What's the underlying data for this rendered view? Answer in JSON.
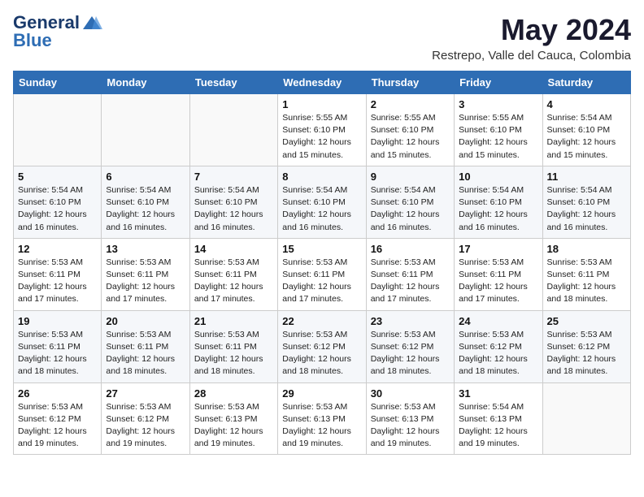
{
  "logo": {
    "line1": "General",
    "line2": "Blue"
  },
  "title": "May 2024",
  "subtitle": "Restrepo, Valle del Cauca, Colombia",
  "days_of_week": [
    "Sunday",
    "Monday",
    "Tuesday",
    "Wednesday",
    "Thursday",
    "Friday",
    "Saturday"
  ],
  "weeks": [
    [
      {
        "day": "",
        "info": ""
      },
      {
        "day": "",
        "info": ""
      },
      {
        "day": "",
        "info": ""
      },
      {
        "day": "1",
        "info": "Sunrise: 5:55 AM\nSunset: 6:10 PM\nDaylight: 12 hours\nand 15 minutes."
      },
      {
        "day": "2",
        "info": "Sunrise: 5:55 AM\nSunset: 6:10 PM\nDaylight: 12 hours\nand 15 minutes."
      },
      {
        "day": "3",
        "info": "Sunrise: 5:55 AM\nSunset: 6:10 PM\nDaylight: 12 hours\nand 15 minutes."
      },
      {
        "day": "4",
        "info": "Sunrise: 5:54 AM\nSunset: 6:10 PM\nDaylight: 12 hours\nand 15 minutes."
      }
    ],
    [
      {
        "day": "5",
        "info": "Sunrise: 5:54 AM\nSunset: 6:10 PM\nDaylight: 12 hours\nand 16 minutes."
      },
      {
        "day": "6",
        "info": "Sunrise: 5:54 AM\nSunset: 6:10 PM\nDaylight: 12 hours\nand 16 minutes."
      },
      {
        "day": "7",
        "info": "Sunrise: 5:54 AM\nSunset: 6:10 PM\nDaylight: 12 hours\nand 16 minutes."
      },
      {
        "day": "8",
        "info": "Sunrise: 5:54 AM\nSunset: 6:10 PM\nDaylight: 12 hours\nand 16 minutes."
      },
      {
        "day": "9",
        "info": "Sunrise: 5:54 AM\nSunset: 6:10 PM\nDaylight: 12 hours\nand 16 minutes."
      },
      {
        "day": "10",
        "info": "Sunrise: 5:54 AM\nSunset: 6:10 PM\nDaylight: 12 hours\nand 16 minutes."
      },
      {
        "day": "11",
        "info": "Sunrise: 5:54 AM\nSunset: 6:10 PM\nDaylight: 12 hours\nand 16 minutes."
      }
    ],
    [
      {
        "day": "12",
        "info": "Sunrise: 5:53 AM\nSunset: 6:11 PM\nDaylight: 12 hours\nand 17 minutes."
      },
      {
        "day": "13",
        "info": "Sunrise: 5:53 AM\nSunset: 6:11 PM\nDaylight: 12 hours\nand 17 minutes."
      },
      {
        "day": "14",
        "info": "Sunrise: 5:53 AM\nSunset: 6:11 PM\nDaylight: 12 hours\nand 17 minutes."
      },
      {
        "day": "15",
        "info": "Sunrise: 5:53 AM\nSunset: 6:11 PM\nDaylight: 12 hours\nand 17 minutes."
      },
      {
        "day": "16",
        "info": "Sunrise: 5:53 AM\nSunset: 6:11 PM\nDaylight: 12 hours\nand 17 minutes."
      },
      {
        "day": "17",
        "info": "Sunrise: 5:53 AM\nSunset: 6:11 PM\nDaylight: 12 hours\nand 17 minutes."
      },
      {
        "day": "18",
        "info": "Sunrise: 5:53 AM\nSunset: 6:11 PM\nDaylight: 12 hours\nand 18 minutes."
      }
    ],
    [
      {
        "day": "19",
        "info": "Sunrise: 5:53 AM\nSunset: 6:11 PM\nDaylight: 12 hours\nand 18 minutes."
      },
      {
        "day": "20",
        "info": "Sunrise: 5:53 AM\nSunset: 6:11 PM\nDaylight: 12 hours\nand 18 minutes."
      },
      {
        "day": "21",
        "info": "Sunrise: 5:53 AM\nSunset: 6:11 PM\nDaylight: 12 hours\nand 18 minutes."
      },
      {
        "day": "22",
        "info": "Sunrise: 5:53 AM\nSunset: 6:12 PM\nDaylight: 12 hours\nand 18 minutes."
      },
      {
        "day": "23",
        "info": "Sunrise: 5:53 AM\nSunset: 6:12 PM\nDaylight: 12 hours\nand 18 minutes."
      },
      {
        "day": "24",
        "info": "Sunrise: 5:53 AM\nSunset: 6:12 PM\nDaylight: 12 hours\nand 18 minutes."
      },
      {
        "day": "25",
        "info": "Sunrise: 5:53 AM\nSunset: 6:12 PM\nDaylight: 12 hours\nand 18 minutes."
      }
    ],
    [
      {
        "day": "26",
        "info": "Sunrise: 5:53 AM\nSunset: 6:12 PM\nDaylight: 12 hours\nand 19 minutes."
      },
      {
        "day": "27",
        "info": "Sunrise: 5:53 AM\nSunset: 6:12 PM\nDaylight: 12 hours\nand 19 minutes."
      },
      {
        "day": "28",
        "info": "Sunrise: 5:53 AM\nSunset: 6:13 PM\nDaylight: 12 hours\nand 19 minutes."
      },
      {
        "day": "29",
        "info": "Sunrise: 5:53 AM\nSunset: 6:13 PM\nDaylight: 12 hours\nand 19 minutes."
      },
      {
        "day": "30",
        "info": "Sunrise: 5:53 AM\nSunset: 6:13 PM\nDaylight: 12 hours\nand 19 minutes."
      },
      {
        "day": "31",
        "info": "Sunrise: 5:54 AM\nSunset: 6:13 PM\nDaylight: 12 hours\nand 19 minutes."
      },
      {
        "day": "",
        "info": ""
      }
    ]
  ]
}
